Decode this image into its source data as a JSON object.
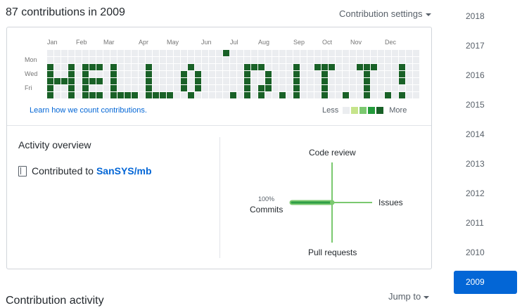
{
  "header": {
    "title": "87 contributions in 2009",
    "settings_label": "Contribution settings"
  },
  "graph": {
    "months": [
      "Jan",
      "Feb",
      "Mar",
      "Apr",
      "May",
      "Jun",
      "Jul",
      "Aug",
      "Sep",
      "Oct",
      "Nov",
      "Dec"
    ],
    "days": [
      "Mon",
      "Wed",
      "Fri"
    ],
    "learn_link": "Learn how we count contributions.",
    "legend_less": "Less",
    "legend_more": "More",
    "colors": {
      "empty": "#ebedf0",
      "l1": "#c6e48b",
      "l2": "#7bc96f",
      "l3": "#239a3b",
      "l4": "#196127"
    },
    "contributed_cells": [
      [
        0,
        2
      ],
      [
        0,
        3
      ],
      [
        0,
        4
      ],
      [
        0,
        5
      ],
      [
        0,
        6
      ],
      [
        1,
        4
      ],
      [
        2,
        4
      ],
      [
        3,
        2
      ],
      [
        3,
        3
      ],
      [
        3,
        4
      ],
      [
        3,
        5
      ],
      [
        3,
        6
      ],
      [
        5,
        2
      ],
      [
        5,
        3
      ],
      [
        5,
        4
      ],
      [
        5,
        5
      ],
      [
        5,
        6
      ],
      [
        6,
        2
      ],
      [
        6,
        4
      ],
      [
        6,
        6
      ],
      [
        7,
        2
      ],
      [
        7,
        4
      ],
      [
        7,
        6
      ],
      [
        9,
        2
      ],
      [
        9,
        3
      ],
      [
        9,
        4
      ],
      [
        9,
        5
      ],
      [
        9,
        6
      ],
      [
        10,
        6
      ],
      [
        11,
        6
      ],
      [
        12,
        6
      ],
      [
        14,
        2
      ],
      [
        14,
        3
      ],
      [
        14,
        4
      ],
      [
        14,
        5
      ],
      [
        14,
        6
      ],
      [
        15,
        6
      ],
      [
        16,
        6
      ],
      [
        17,
        6
      ],
      [
        19,
        3
      ],
      [
        19,
        4
      ],
      [
        19,
        5
      ],
      [
        20,
        2
      ],
      [
        20,
        6
      ],
      [
        21,
        3
      ],
      [
        21,
        4
      ],
      [
        21,
        5
      ],
      [
        25,
        0
      ],
      [
        26,
        6
      ],
      [
        28,
        2
      ],
      [
        28,
        3
      ],
      [
        28,
        4
      ],
      [
        28,
        5
      ],
      [
        28,
        6
      ],
      [
        29,
        2
      ],
      [
        30,
        2
      ],
      [
        30,
        5
      ],
      [
        30,
        6
      ],
      [
        31,
        3
      ],
      [
        31,
        4
      ],
      [
        31,
        5
      ],
      [
        33,
        6
      ],
      [
        35,
        2
      ],
      [
        35,
        3
      ],
      [
        35,
        4
      ],
      [
        35,
        5
      ],
      [
        35,
        6
      ],
      [
        38,
        2
      ],
      [
        39,
        2
      ],
      [
        39,
        3
      ],
      [
        39,
        4
      ],
      [
        39,
        5
      ],
      [
        39,
        6
      ],
      [
        40,
        2
      ],
      [
        42,
        6
      ],
      [
        44,
        2
      ],
      [
        45,
        2
      ],
      [
        45,
        3
      ],
      [
        45,
        4
      ],
      [
        45,
        5
      ],
      [
        45,
        6
      ],
      [
        46,
        2
      ],
      [
        48,
        6
      ],
      [
        50,
        2
      ],
      [
        50,
        3
      ],
      [
        50,
        4
      ],
      [
        50,
        6
      ]
    ]
  },
  "overview": {
    "title": "Activity overview",
    "contributed_prefix": "Contributed to",
    "repo": "SanSYS/mb",
    "axis_code_review": "Code review",
    "axis_issues": "Issues",
    "axis_pull_requests": "Pull requests",
    "axis_commits": "Commits",
    "commits_percent": "100%",
    "line_color": "#7bc96f",
    "fill_color": "#2f9e47",
    "commits_fraction": 1.0
  },
  "years": [
    "2018",
    "2017",
    "2016",
    "2015",
    "2014",
    "2013",
    "2012",
    "2011",
    "2010",
    "2009"
  ],
  "active_year": "2009",
  "footer": {
    "activity_title": "Contribution activity",
    "jump_label": "Jump to"
  }
}
